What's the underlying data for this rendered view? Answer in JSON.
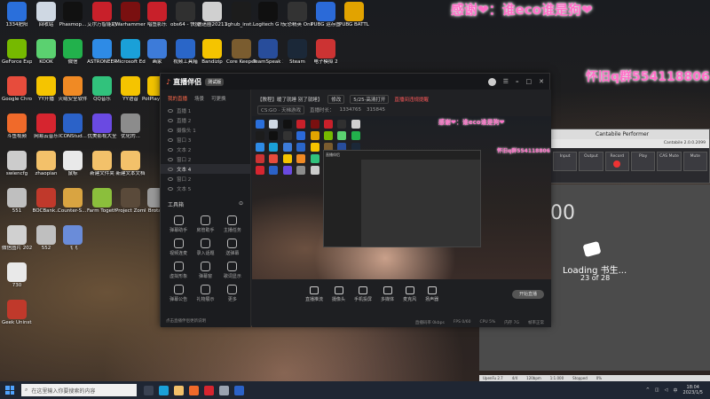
{
  "desktop": {
    "icons": [
      {
        "label": "1334肥阳",
        "color": "#2a6fdb"
      },
      {
        "label": "回收站",
        "color": "#cfd8e3"
      },
      {
        "label": "Phasmop...",
        "color": "#111111"
      },
      {
        "label": "艾尔万智能助理",
        "color": "#c8202a"
      },
      {
        "label": "Warhammer Vermintide...",
        "color": "#7a1010"
      },
      {
        "label": "唱鱼影乐",
        "color": "#c8202a"
      },
      {
        "label": "obs64 - 快捷方式",
        "color": "#303030"
      },
      {
        "label": "德迷圈2021111...",
        "color": "#d0d0d0"
      },
      {
        "label": "lghub_inst...op",
        "color": "#1c1c1c"
      },
      {
        "label": "Logitech G HUB",
        "color": "#101010"
      },
      {
        "label": "反恐精英 Online",
        "color": "#333333"
      },
      {
        "label": "PUBG 运存图",
        "color": "#2b6ad8"
      },
      {
        "label": "PUBG BATTLEGR...",
        "color": "#e2a300"
      },
      {
        "label": "GeForce Experience",
        "color": "#76b900"
      },
      {
        "label": "KOOK",
        "color": "#5bd170"
      },
      {
        "label": "微信",
        "color": "#22b14c"
      },
      {
        "label": "ASTRONEER",
        "color": "#2e8be6"
      },
      {
        "label": "Microsoft Edge",
        "color": "#1aa0d8"
      },
      {
        "label": "画家",
        "color": "#3d7bd9"
      },
      {
        "label": "视频工具箱",
        "color": "#2a66c8"
      },
      {
        "label": "Bandizip",
        "color": "#f5c400"
      },
      {
        "label": "Core Keeper 快...",
        "color": "#7a5c2f"
      },
      {
        "label": "TeamSpeak 3",
        "color": "#284d9b"
      },
      {
        "label": "Steam",
        "color": "#1b2838"
      },
      {
        "label": "电子模拟 2",
        "color": "#cc3333"
      },
      {
        "label": "Google Chrome",
        "color": "#e74c3c"
      },
      {
        "label": "YY开播",
        "color": "#f5c400"
      },
      {
        "label": "火绒安全软件",
        "color": "#f08a24"
      },
      {
        "label": "QQ音乐",
        "color": "#31c27c"
      },
      {
        "label": "YY语音",
        "color": "#f5c400"
      },
      {
        "label": "PotPlayer 64 bit",
        "color": "#f2c300"
      },
      {
        "label": "斗鱼视频",
        "color": "#f06a2a"
      },
      {
        "label": "网易云音乐",
        "color": "#d6252f"
      },
      {
        "label": "ICONStud...",
        "color": "#2b62c8"
      },
      {
        "label": "优美影视大全",
        "color": "#6a4ae2"
      },
      {
        "label": "优化的...",
        "color": "#8c8c8c"
      },
      {
        "label": "swiencfg",
        "color": "#cccccc"
      },
      {
        "label": "zhaopian",
        "color": "#f3c16a"
      },
      {
        "label": "鼠标",
        "color": "#e9e9e9"
      },
      {
        "label": "新建文件夹",
        "color": "#f3c16a"
      },
      {
        "label": "新建文本文档",
        "color": "#f3c16a"
      },
      {
        "label": "551",
        "color": "#bfbfbf"
      },
      {
        "label": "BOCBank...",
        "color": "#c0392b"
      },
      {
        "label": "Counter-S... Global Off...",
        "color": "#d9a441"
      },
      {
        "label": "Farm Together",
        "color": "#8bbf3c"
      },
      {
        "label": "Project Zomboid",
        "color": "#5a4a3a"
      },
      {
        "label": "Brotato",
        "color": "#999999"
      },
      {
        "label": "微信图片 2022051...",
        "color": "#d0d0d0"
      },
      {
        "label": "552",
        "color": "#bfbfbf"
      },
      {
        "label": "飞飞",
        "color": "#6a8cd9"
      },
      {
        "label": "730",
        "color": "#e9e9e9"
      },
      {
        "label": "Geek Uninstaller",
        "color": "#c0392b"
      }
    ]
  },
  "overlays": {
    "thanks": "感谢❤：谁eco谁是狗❤",
    "qq_group": "怀旧q群554118806"
  },
  "app": {
    "title": "直播伴侣",
    "badge": "测试版",
    "side_tabs": [
      "我的直播",
      "场景",
      "可更换"
    ],
    "scenes": [
      {
        "label": "直播 1",
        "selected": false
      },
      {
        "label": "直播 2",
        "selected": false
      },
      {
        "label": "摄像头 1",
        "selected": false
      },
      {
        "label": "窗口 3",
        "selected": false
      },
      {
        "label": "文本 2",
        "selected": false
      },
      {
        "label": "窗口 2",
        "selected": false
      },
      {
        "label": "文本 4",
        "selected": true
      },
      {
        "label": "窗口 2",
        "selected": false
      },
      {
        "label": "文本 5",
        "selected": false
      }
    ],
    "tools_title": "工具箱",
    "tools": [
      "弹幕助手",
      "房管助手",
      "主播任务",
      "视频连麦",
      "录入话题",
      "送弹幕",
      "虚拟形象",
      "弹幕窗",
      "歌词显示",
      "弹幕公告",
      "礼物展示",
      "更多"
    ],
    "sidebar_footer": "点击直播伴侣更新说明",
    "top_row1": [
      "【教程】暖了就睡 别了就睡】",
      "修改",
      "5/25·高清打开",
      "直播间违规提醒"
    ],
    "top_row2": [
      "CS:GO · 天梯游戏",
      "直播时长：",
      "1334765",
      "315845"
    ],
    "bottom_buttons": [
      "直播推流",
      "摄像头",
      "手机投屏",
      "多媒体",
      "麦克风",
      "扬声器"
    ],
    "start_live": "开始直播",
    "stats": [
      "直播码率 0kbps",
      "FPS 0/60",
      "CPU 5%",
      "内存 7G",
      "帧率正常"
    ]
  },
  "cantabile": {
    "title": "Cantabile Performer",
    "status_bar": "Cantabile 2.0.0.2099",
    "buttons": [
      "Input",
      "Output",
      "Record",
      "Play",
      "CAS Mute",
      "Mute"
    ]
  },
  "right_panel": {
    "big_number": "00",
    "loading_text": "Loading 书生...",
    "loading_count": "23 of 28"
  },
  "daw_strip": [
    "UpenFu 2.7",
    "4/4",
    "120bpm",
    "1:1.000",
    "Stopped",
    "0%"
  ],
  "taskbar": {
    "search_placeholder": "在这里输入你要搜索的内容",
    "time": "18:04",
    "date": "2023/1/5"
  }
}
